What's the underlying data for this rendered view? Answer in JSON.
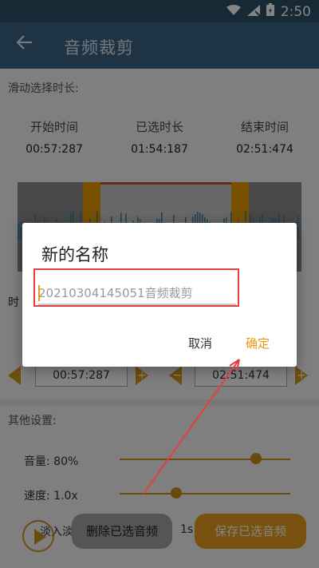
{
  "status": {
    "time": "2:50"
  },
  "app_bar": {
    "title": "音频裁剪"
  },
  "section1": {
    "label": "滑动选择时长:"
  },
  "times": {
    "start_label": "开始时间",
    "start_value": "00:57:287",
    "selected_label": "已选时长",
    "selected_value": "01:54:187",
    "end_label": "结束时间",
    "end_value": "02:51:474"
  },
  "controls": {
    "prefix": "时",
    "start_value": "00:57:287",
    "end_value": "02:51:474",
    "minus": "−",
    "plus": "+"
  },
  "other": {
    "label": "其他设置:",
    "volume": "音量: 80%",
    "volume_level": 0.8,
    "speed": "速度: 1.0x",
    "speed_level": 0.33,
    "fade": "淡入淡出",
    "fade_value": "1s"
  },
  "buttons": {
    "delete": "删除已选音频",
    "save": "保存已选音频"
  },
  "dialog": {
    "title": "新的名称",
    "input_value": "20210304145051音频裁剪",
    "cancel": "取消",
    "ok": "确定"
  },
  "colors": {
    "accent": "#e59910",
    "app_bar": "#3b6585",
    "annotation": "#e04040"
  }
}
